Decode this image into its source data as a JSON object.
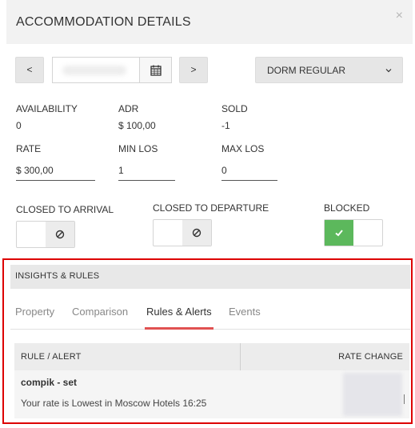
{
  "header": {
    "title": "ACCOMMODATION DETAILS",
    "close_label": "×"
  },
  "toolbar": {
    "prev_label": "<",
    "next_label": ">",
    "date_value": "",
    "room_type": "DORM REGULAR"
  },
  "stats": {
    "availability_label": "AVAILABILITY",
    "availability_value": "0",
    "adr_label": "ADR",
    "adr_value": "$ 100,00",
    "sold_label": "SOLD",
    "sold_value": "-1"
  },
  "fields": {
    "rate_label": "RATE",
    "rate_value": "$ 300,00",
    "min_los_label": "MIN LOS",
    "min_los_value": "1",
    "max_los_label": "MAX LOS",
    "max_los_value": "0"
  },
  "toggles": {
    "cta_label": "CLOSED TO ARRIVAL",
    "cta_on": false,
    "ctd_label": "CLOSED TO DEPARTURE",
    "ctd_on": false,
    "blocked_label": "BLOCKED",
    "blocked_on": true
  },
  "insights": {
    "title": "INSIGHTS & RULES",
    "tabs": [
      {
        "label": "Property",
        "active": false
      },
      {
        "label": "Comparison",
        "active": false
      },
      {
        "label": "Rules & Alerts",
        "active": true
      },
      {
        "label": "Events",
        "active": false
      }
    ],
    "table": {
      "col_rule": "RULE / ALERT",
      "col_rate": "RATE CHANGE",
      "rows": [
        {
          "name": "compik - set",
          "message": "Your rate is Lowest in Moscow Hotels 16:25"
        }
      ]
    }
  },
  "colors": {
    "accent_red": "#e05151",
    "highlight_border": "#dd0000",
    "toggle_on": "#5cb85c"
  },
  "icons": [
    "close-icon",
    "calendar-icon",
    "chevron-down-icon",
    "ban-icon",
    "check-icon"
  ]
}
